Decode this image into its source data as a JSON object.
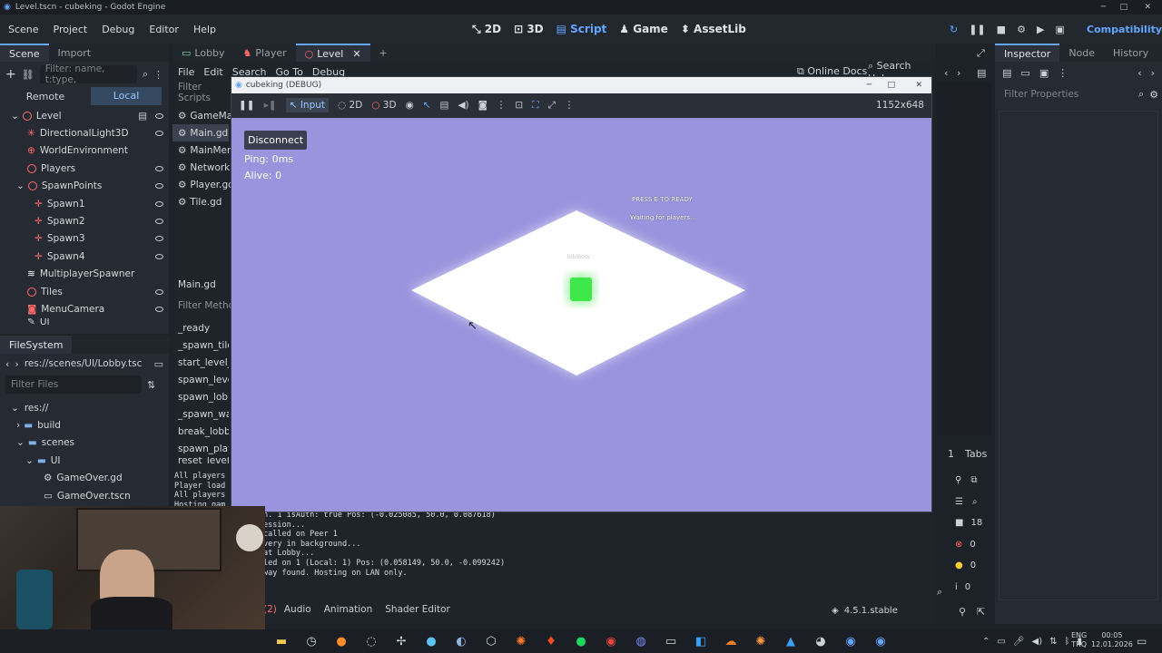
{
  "title_bar": "Level.tscn - cubeking - Godot Engine",
  "menu": [
    "Scene",
    "Project",
    "Debug",
    "Editor",
    "Help"
  ],
  "modes": [
    "2D",
    "3D",
    "Script",
    "Game",
    "AssetLib"
  ],
  "renderer": "Compatibility",
  "scene_dock": {
    "tabs": [
      "Scene",
      "Import"
    ],
    "filter_placeholder": "Filter: name, t:type,",
    "remote": "Remote",
    "local": "Local",
    "nodes": [
      "Level",
      "DirectionalLight3D",
      "WorldEnvironment",
      "Players",
      "SpawnPoints",
      "Spawn1",
      "Spawn2",
      "Spawn3",
      "Spawn4",
      "MultiplayerSpawner",
      "Tiles",
      "MenuCamera",
      "UI"
    ]
  },
  "filesystem": {
    "title": "FileSystem",
    "path": "res://scenes/UI/Lobby.tsc",
    "filter": "Filter Files",
    "items": [
      "res://",
      "build",
      "scenes",
      "UI",
      "GameOver.gd",
      "GameOver.tscn"
    ]
  },
  "script_tabs": [
    "Lobby",
    "Player",
    "Level"
  ],
  "script_menu": [
    "File",
    "Edit",
    "Search",
    "Go To",
    "Debug"
  ],
  "filter_scripts": "Filter Scripts",
  "scripts": [
    "GameMan",
    "Main.gd",
    "MainMen",
    "NetworkM",
    "Player.gd",
    "Tile.gd"
  ],
  "current_script": "Main.gd",
  "filter_methods": "Filter Metho",
  "methods": [
    "_ready",
    "_spawn_tile",
    "start_level_lo",
    "spawn_level_",
    "spawn_lobby",
    "_spawn_wall",
    "break_lobby_",
    "spawn_playe",
    "reset_level"
  ],
  "script_right": {
    "online_docs": "Online Docs",
    "search_help": "Search Help"
  },
  "console_left": [
    "All players",
    "Player load",
    "All players",
    "Hosting gam"
  ],
  "console": [
    "n. 1 isAuth: true Pos: (-0.025085, 50.0, 0.087618)",
    "ession...",
    "called on Peer 1",
    "very in background...",
    "at Lobby...",
    "led on 1 (Local: 1) Pos: (0.058149, 50.0, -0.099242)",
    "way found. Hosting on LAN only."
  ],
  "bottom_tabs": [
    "(2)",
    "Audio",
    "Animation",
    "Shader Editor"
  ],
  "version": "4.5.1.stable",
  "debug_window": {
    "title": "cubeking (DEBUG)",
    "toolbar": [
      "Input",
      "2D",
      "3D"
    ],
    "resolution": "1152x648",
    "disconnect": "Disconnect",
    "ping": "Ping: 0ms",
    "alive": "Alive: 0",
    "hint1": "PRESS E TO READY",
    "hint2": "Waiting for players...",
    "cube_label": "bibiBoss"
  },
  "inspector": {
    "tabs": [
      "Inspector",
      "Node",
      "History"
    ],
    "filter": "Filter Properties"
  },
  "right_counts": {
    "tabs_label": "Tabs",
    "tabs_num": "1",
    "c1": "18",
    "c2": "0",
    "c3": "0",
    "c4": "0"
  },
  "clock": {
    "lang1": "ENG",
    "lang2": "TRQ",
    "time": "00:05",
    "date": "12.01.2026"
  },
  "colors": {
    "accent": "#64a6ff",
    "viewport": "#9a94de",
    "cube": "#3fe84a"
  }
}
